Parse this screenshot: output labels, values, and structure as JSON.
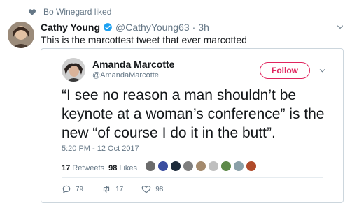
{
  "social_context": {
    "icon": "heart-icon",
    "text": "Bo Winegard liked"
  },
  "tweet": {
    "author_name": "Cathy Young",
    "verified_icon": "verified-badge-icon",
    "handle": "@CathyYoung63",
    "separator": "·",
    "time": "3h",
    "text": "This is the marcottest tweet that ever marcotted"
  },
  "quoted_tweet": {
    "author_name": "Amanda Marcotte",
    "handle": "@AmandaMarcotte",
    "follow_label": "Follow",
    "body": "“I see no reason a man shouldn’t be keynote at a woman’s conference” is the new “of course I do it in the butt”.",
    "timestamp": "5:20 PM - 12 Oct 2017",
    "retweets_count": "17",
    "retweets_label": "Retweets",
    "likes_count": "98",
    "likes_label": "Likes",
    "likers_count_shown": 9,
    "replies": "79",
    "retweets": "17",
    "likes": "98"
  },
  "colors": {
    "accent": "#e0245e",
    "verified": "#1da1f2",
    "muted": "#657786",
    "border": "#ccd6dd"
  }
}
